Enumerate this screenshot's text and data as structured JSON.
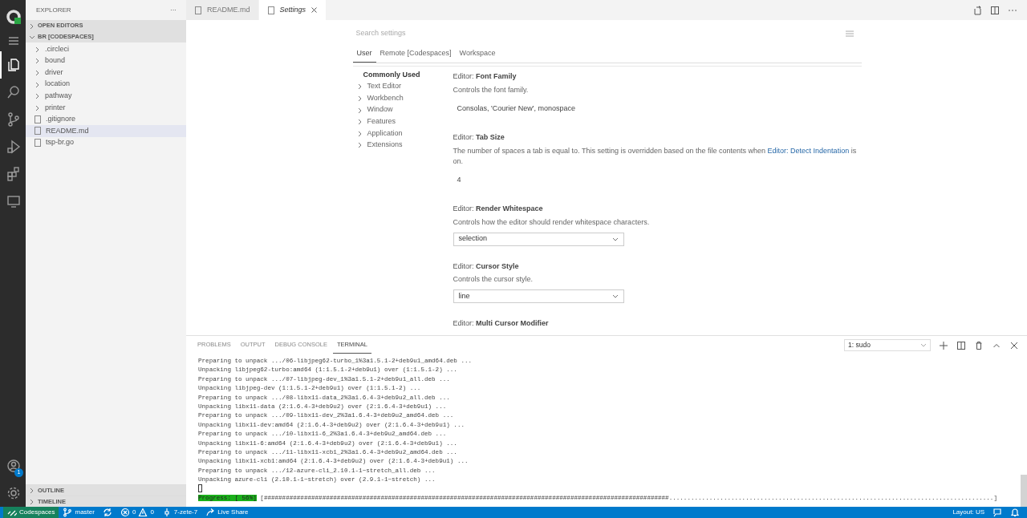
{
  "activity_bar": [
    {
      "kind": "logo",
      "selected": false
    },
    {
      "kind": "menu",
      "selected": false
    },
    {
      "kind": "explorer",
      "selected": true
    },
    {
      "kind": "search",
      "selected": false
    },
    {
      "kind": "scm",
      "selected": false
    },
    {
      "kind": "run",
      "selected": false
    },
    {
      "kind": "extensions",
      "selected": false
    },
    {
      "kind": "remote",
      "selected": false
    }
  ],
  "accounts_badge": "1",
  "sidebar": {
    "title": "EXPLORER",
    "more": "···",
    "sections": [
      {
        "label": "OPEN EDITORS",
        "expanded": false
      },
      {
        "label": "BR [CODESPACES]",
        "expanded": true,
        "items": [
          {
            "name": ".circleci",
            "kind": "folder",
            "selected": false
          },
          {
            "name": "bound",
            "kind": "folder",
            "selected": false
          },
          {
            "name": "driver",
            "kind": "folder",
            "selected": false
          },
          {
            "name": "location",
            "kind": "folder",
            "selected": false
          },
          {
            "name": "pathway",
            "kind": "folder",
            "selected": false
          },
          {
            "name": "printer",
            "kind": "folder",
            "selected": false
          },
          {
            "name": ".gitignore",
            "kind": "file",
            "selected": false
          },
          {
            "name": "README.md",
            "kind": "file",
            "selected": true
          },
          {
            "name": "tsp-br.go",
            "kind": "file",
            "selected": false
          }
        ]
      }
    ],
    "bottom_sections": [
      {
        "label": "OUTLINE",
        "expanded": false
      },
      {
        "label": "TIMELINE",
        "expanded": false
      }
    ]
  },
  "editor_tabs": [
    {
      "label": "README.md",
      "selected": false,
      "preview": false
    },
    {
      "label": "Settings",
      "selected": true,
      "preview": true
    }
  ],
  "settings": {
    "search": {
      "placeholder": "Search settings"
    },
    "scopes": [
      {
        "label": "User",
        "selected": true
      },
      {
        "label": "Remote [Codespaces]",
        "selected": false
      },
      {
        "label": "Workspace",
        "selected": false
      }
    ],
    "toc": [
      {
        "label": "Commonly Used",
        "kind": "heading"
      },
      {
        "label": "Text Editor",
        "kind": "group"
      },
      {
        "label": "Workbench",
        "kind": "group"
      },
      {
        "label": "Window",
        "kind": "group"
      },
      {
        "label": "Features",
        "kind": "group"
      },
      {
        "label": "Application",
        "kind": "group"
      },
      {
        "label": "Extensions",
        "kind": "group"
      }
    ],
    "items": [
      {
        "category": "Editor: ",
        "title": "Font Family",
        "kind": "text",
        "description": "Controls the font family.",
        "value": "Consolas, 'Courier New', monospace"
      },
      {
        "category": "Editor: ",
        "title": "Tab Size",
        "kind": "number",
        "description": "The number of spaces a tab is equal to. This setting is overridden based on the file contents when ",
        "link": "Editor: Detect Indentation",
        "description_after": " is on.",
        "value": "4"
      },
      {
        "category": "Editor: ",
        "title": "Render Whitespace",
        "kind": "select",
        "description": "Controls how the editor should render whitespace characters.",
        "value": "selection"
      },
      {
        "category": "Editor: ",
        "title": "Cursor Style",
        "kind": "select",
        "description": "Controls the cursor style.",
        "value": "line"
      },
      {
        "category": "Editor: ",
        "title": "Multi Cursor Modifier",
        "kind": "title"
      }
    ]
  },
  "panel": {
    "tabs": [
      {
        "label": "PROBLEMS",
        "selected": false
      },
      {
        "label": "OUTPUT",
        "selected": false
      },
      {
        "label": "DEBUG CONSOLE",
        "selected": false
      },
      {
        "label": "TERMINAL",
        "selected": true
      }
    ],
    "terminal_select": "1: sudo",
    "lines": [
      "Preparing to unpack .../06-libjpeg62-turbo_1%3a1.5.1-2+deb9u1_amd64.deb ...",
      "Unpacking libjpeg62-turbo:amd64 (1:1.5.1-2+deb9u1) over (1:1.5.1-2) ...",
      "Preparing to unpack .../07-libjpeg-dev_1%3a1.5.1-2+deb9u1_all.deb ...",
      "Unpacking libjpeg-dev (1:1.5.1-2+deb9u1) over (1:1.5.1-2) ...",
      "Preparing to unpack .../08-libx11-data_2%3a1.6.4-3+deb9u2_all.deb ...",
      "Unpacking libx11-data (2:1.6.4-3+deb9u2) over (2:1.6.4-3+deb9u1) ...",
      "Preparing to unpack .../09-libx11-dev_2%3a1.6.4-3+deb9u2_amd64.deb ...",
      "Unpacking libx11-dev:amd64 (2:1.6.4-3+deb9u2) over (2:1.6.4-3+deb9u1) ...",
      "Preparing to unpack .../10-libx11-6_2%3a1.6.4-3+deb9u2_amd64.deb ...",
      "Unpacking libx11-6:amd64 (2:1.6.4-3+deb9u2) over (2:1.6.4-3+deb9u1) ...",
      "Preparing to unpack .../11-libx11-xcb1_2%3a1.6.4-3+deb9u2_amd64.deb ...",
      "Unpacking libx11-xcb1:amd64 (2:1.6.4-3+deb9u2) over (2:1.6.4-3+deb9u1) ...",
      "Preparing to unpack .../12-azure-cli_2.10.1-1~stretch_all.deb ...",
      "Unpacking azure-cli (2.10.1-1~stretch) over (2.9.1-1~stretch) ..."
    ],
    "progress": {
      "label": "Progress: [ 56%]",
      "bar": "[###############################################################################################################.........................................................................................]"
    }
  },
  "status_bar": {
    "left": [
      {
        "kind": "remote",
        "text": "Codespaces"
      },
      {
        "kind": "branch",
        "text": "master"
      },
      {
        "kind": "sync"
      },
      {
        "kind": "problems",
        "errors": "0",
        "warnings": "0"
      },
      {
        "kind": "ports",
        "text": "7-zete-7"
      },
      {
        "kind": "liveshare",
        "text": "Live Share"
      }
    ],
    "right": [
      {
        "kind": "text",
        "text": "Layout: US"
      },
      {
        "kind": "feedback"
      },
      {
        "kind": "bell"
      }
    ]
  }
}
